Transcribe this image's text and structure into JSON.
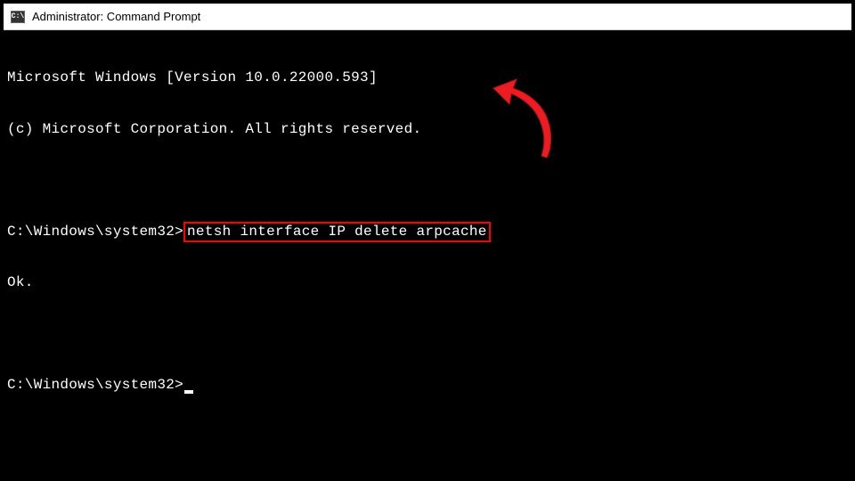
{
  "titlebar": {
    "icon_label": "C:\\",
    "title": "Administrator: Command Prompt"
  },
  "terminal": {
    "line1": "Microsoft Windows [Version 10.0.22000.593]",
    "line2": "(c) Microsoft Corporation. All rights reserved.",
    "prompt1_path": "C:\\Windows\\system32>",
    "command1": "netsh interface IP delete arpcache",
    "response1": "Ok.",
    "prompt2_path": "C:\\Windows\\system32>"
  },
  "annotation": {
    "color": "#ed1c24"
  }
}
